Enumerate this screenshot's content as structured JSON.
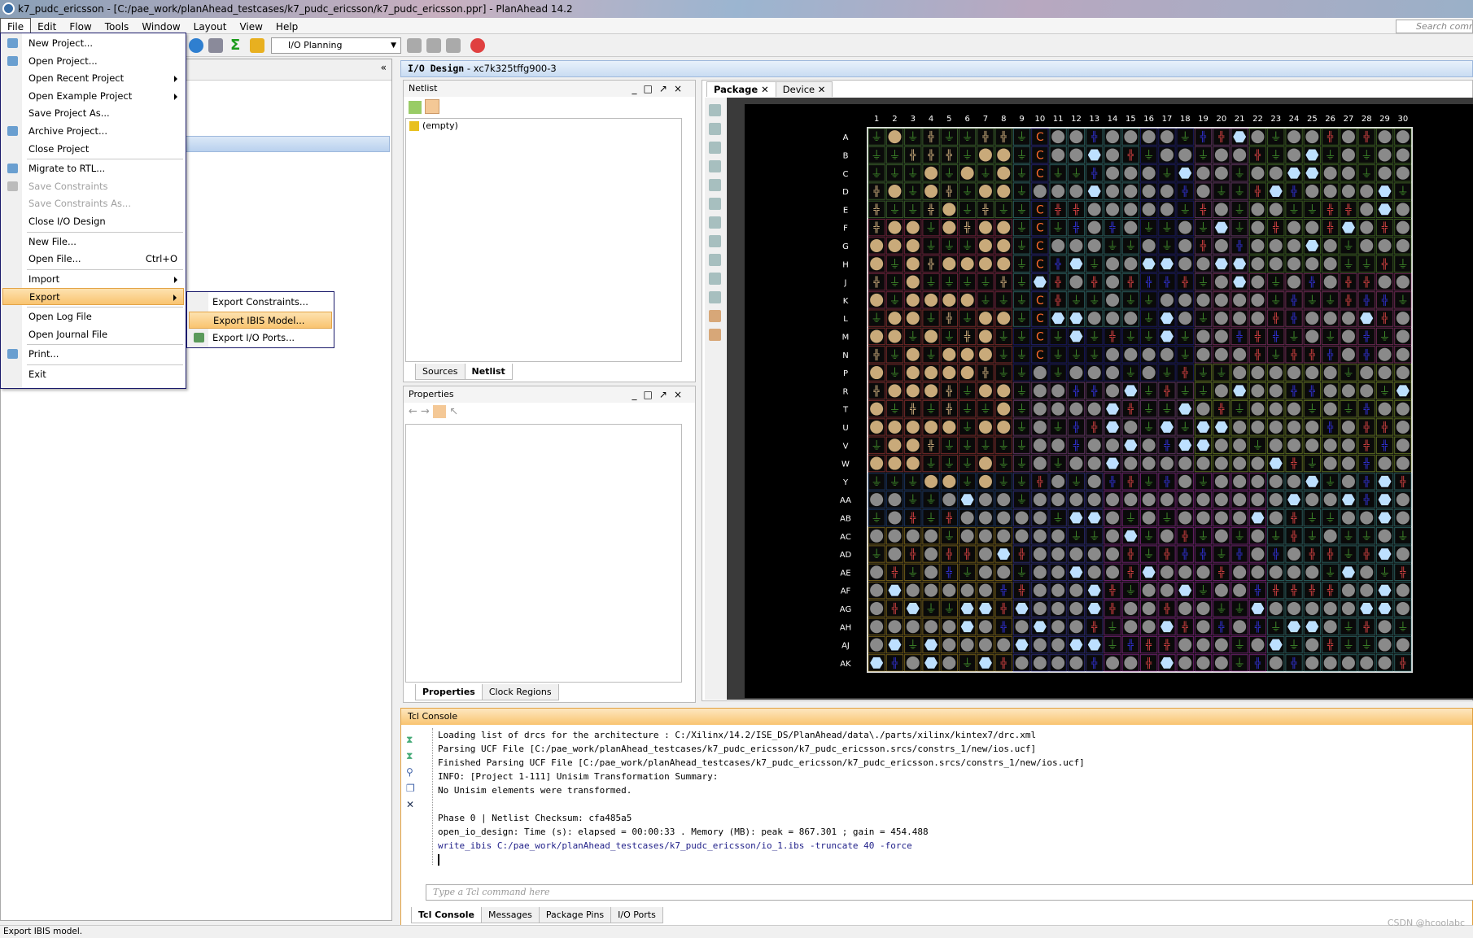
{
  "window": {
    "title": "k7_pudc_ericsson - [C:/pae_work/planAhead_testcases/k7_pudc_ericsson/k7_pudc_ericsson.ppr] - PlanAhead  14.2"
  },
  "menubar": [
    "File",
    "Edit",
    "Flow",
    "Tools",
    "Window",
    "Layout",
    "View",
    "Help"
  ],
  "search_placeholder": "Search commands",
  "toolbar": {
    "layout": "I/O Planning"
  },
  "file_menu": [
    {
      "label": "New Project...",
      "icon": "new-project-icon"
    },
    {
      "label": "Open Project...",
      "icon": "open-project-icon"
    },
    {
      "label": "Open Recent Project",
      "submenu": true
    },
    {
      "label": "Open Example Project",
      "submenu": true
    },
    {
      "label": "Save Project As..."
    },
    {
      "label": "Archive Project...",
      "icon": "archive-icon"
    },
    {
      "label": "Close Project",
      "sep_after": true
    },
    {
      "label": "Migrate to RTL...",
      "icon": "migrate-icon"
    },
    {
      "label": "Save Constraints",
      "disabled": true,
      "icon": "save-icon"
    },
    {
      "label": "Save Constraints As...",
      "disabled": true
    },
    {
      "label": "Close I/O Design",
      "sep_after": true
    },
    {
      "label": "New File..."
    },
    {
      "label": "Open File...",
      "shortcut": "Ctrl+O",
      "sep_after": true
    },
    {
      "label": "Import",
      "submenu": true
    },
    {
      "label": "Export",
      "submenu": true,
      "highlighted": true,
      "sep_after": true
    },
    {
      "label": "Open Log File"
    },
    {
      "label": "Open Journal File",
      "sep_after": true
    },
    {
      "label": "Print...",
      "icon": "print-icon",
      "sep_after": true
    },
    {
      "label": "Exit"
    }
  ],
  "export_submenu": [
    {
      "label": "Export Constraints..."
    },
    {
      "label": "Export IBIS Model...",
      "highlighted": true
    },
    {
      "label": "Export I/O Ports...",
      "icon": "export-ports-icon"
    }
  ],
  "io_design": {
    "title": "I/O Design",
    "part": " - xc7k325tffg900-3"
  },
  "netlist": {
    "title": "Netlist",
    "item": "(empty)",
    "tabs": [
      "Sources",
      "Netlist"
    ],
    "active_tab": "Netlist"
  },
  "properties": {
    "title": "Properties",
    "tabs": [
      "Properties",
      "Clock Regions"
    ],
    "active_tab": "Properties"
  },
  "package_tabs": [
    {
      "label": "Package",
      "active": true
    },
    {
      "label": "Device"
    }
  ],
  "package": {
    "columns": [
      "1",
      "2",
      "3",
      "4",
      "5",
      "6",
      "7",
      "8",
      "9",
      "10",
      "11",
      "12",
      "13",
      "14",
      "15",
      "16",
      "17",
      "18",
      "19",
      "20",
      "21",
      "22",
      "23",
      "24",
      "25",
      "26",
      "27",
      "28",
      "29",
      "30"
    ],
    "rows": [
      "A",
      "B",
      "C",
      "D",
      "E",
      "F",
      "G",
      "H",
      "J",
      "K",
      "L",
      "M",
      "N",
      "P",
      "R",
      "T",
      "U",
      "V",
      "W",
      "Y",
      "AA",
      "AB",
      "AC",
      "AD",
      "AE",
      "AF",
      "AG",
      "AH",
      "AJ",
      "AK"
    ],
    "colors": {
      "gnd": "#3f8a2a",
      "user": "#c9aa7a",
      "io": "#8a8a8a",
      "hex": "#bde0ff",
      "clock": "#ff6a2a",
      "vcc": "#d04040",
      "vref": "#3030d0"
    }
  },
  "tcl_console": {
    "title": "Tcl Console",
    "lines": [
      "Loading list of drcs for the architecture : C:/Xilinx/14.2/ISE_DS/PlanAhead/data\\./parts/xilinx/kintex7/drc.xml",
      "Parsing UCF File [C:/pae_work/planAhead_testcases/k7_pudc_ericsson/k7_pudc_ericsson.srcs/constrs_1/new/ios.ucf]",
      "Finished Parsing UCF File [C:/pae_work/planAhead_testcases/k7_pudc_ericsson/k7_pudc_ericsson.srcs/constrs_1/new/ios.ucf]",
      "INFO: [Project 1-111] Unisim Transformation Summary:",
      "No Unisim elements were transformed.",
      "",
      "Phase 0 | Netlist Checksum: cfa485a5",
      "open_io_design: Time (s): elapsed = 00:00:33 . Memory (MB): peak = 867.301 ; gain = 454.488"
    ],
    "command": "write_ibis C:/pae_work/planAhead_testcases/k7_pudc_ericsson/io_1.ibs -truncate 40 -force",
    "placeholder": "Type a Tcl command here",
    "tabs": [
      "Tcl Console",
      "Messages",
      "Package Pins",
      "I/O Ports"
    ],
    "active_tab": "Tcl Console"
  },
  "status": "Export IBIS model.",
  "watermark": "CSDN @hcoolabc"
}
